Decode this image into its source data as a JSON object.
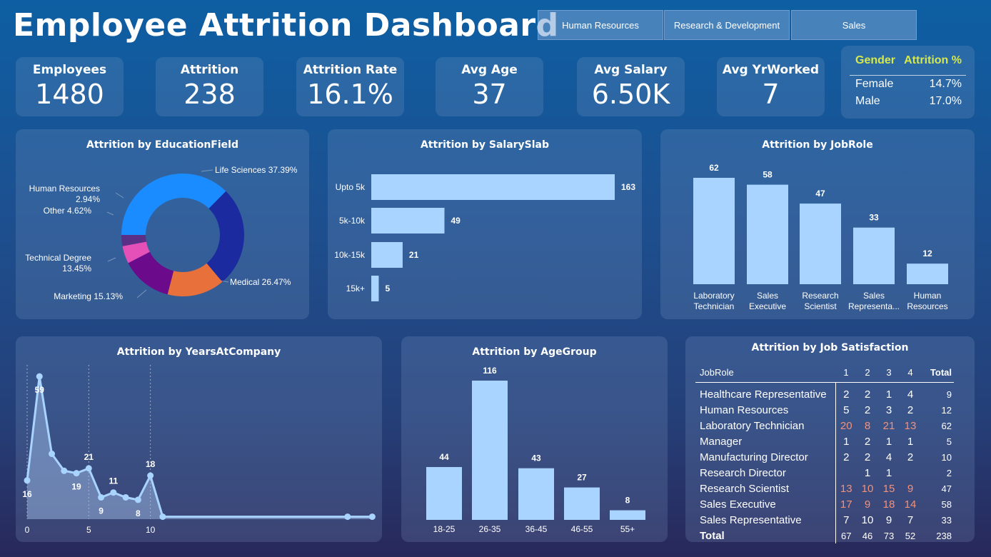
{
  "header": {
    "title": "Employee Attrition Dashboard",
    "filters": [
      "Human Resources",
      "Research & Development",
      "Sales"
    ]
  },
  "kpis": [
    {
      "label": "Employees",
      "value": "1480"
    },
    {
      "label": "Attrition",
      "value": "238"
    },
    {
      "label": "Attrition Rate",
      "value": "16.1%"
    },
    {
      "label": "Avg Age",
      "value": "37"
    },
    {
      "label": "Avg Salary",
      "value": "6.50K"
    },
    {
      "label": "Avg YrWorked",
      "value": "7"
    }
  ],
  "gender": {
    "col1": "Gender",
    "col2": "Attrition %",
    "rows": [
      {
        "g": "Female",
        "v": "14.7%"
      },
      {
        "g": "Male",
        "v": "17.0%"
      }
    ]
  },
  "colors": {
    "bar": "#a8d4ff",
    "accent": "#d6e84a",
    "highlight": "#f2917a"
  },
  "chart_data": [
    {
      "id": "education",
      "type": "pie",
      "title": "Attrition by EducationField",
      "slices": [
        {
          "label": "Life Sciences",
          "pct": 37.39,
          "text": "Life Sciences 37.39%",
          "color": "#1a8cff"
        },
        {
          "label": "Medical",
          "pct": 26.47,
          "text": "Medical 26.47%",
          "color": "#1c2aa0"
        },
        {
          "label": "Marketing",
          "pct": 15.13,
          "text": "Marketing 15.13%",
          "color": "#e8703a"
        },
        {
          "label": "Technical Degree",
          "pct": 13.45,
          "text": "Technical Degree 13.45%",
          "color": "#6b0a8a"
        },
        {
          "label": "Other",
          "pct": 4.62,
          "text": "Other 4.62%",
          "color": "#e44fb8"
        },
        {
          "label": "Human Resources",
          "pct": 2.94,
          "text": "Human Resources 2.94%",
          "color": "#5a2f86"
        }
      ]
    },
    {
      "id": "salary",
      "type": "bar",
      "title": "Attrition by SalarySlab",
      "orientation": "horizontal",
      "categories": [
        "Upto 5k",
        "5k-10k",
        "10k-15k",
        "15k+"
      ],
      "values": [
        163,
        49,
        21,
        5
      ]
    },
    {
      "id": "jobrole",
      "type": "bar",
      "title": "Attrition by JobRole",
      "categories": [
        [
          "Laboratory",
          "Technician"
        ],
        [
          "Sales",
          "Executive"
        ],
        [
          "Research",
          "Scientist"
        ],
        [
          "Sales",
          "Representa..."
        ],
        [
          "Human",
          "Resources"
        ]
      ],
      "values": [
        62,
        58,
        47,
        33,
        12
      ]
    },
    {
      "id": "years",
      "type": "area",
      "title": "Attrition by YearsAtCompany",
      "x": [
        0,
        1,
        2,
        3,
        4,
        5,
        6,
        7,
        8,
        9,
        10,
        11,
        12,
        13,
        14,
        15,
        16,
        17,
        18,
        19,
        20,
        21,
        22,
        23,
        24,
        25,
        26,
        27,
        28
      ],
      "y": [
        16,
        59,
        27,
        20,
        19,
        21,
        9,
        11,
        9,
        8,
        18,
        1,
        1,
        1,
        1,
        1,
        1,
        1,
        1,
        1,
        1,
        1,
        1,
        1,
        1,
        1,
        1,
        1,
        1
      ],
      "markers": [
        0,
        1,
        2,
        3,
        4,
        5,
        6,
        7,
        8,
        9,
        10,
        11,
        26,
        28
      ],
      "data_labels": [
        {
          "i": 0,
          "text": "16"
        },
        {
          "i": 1,
          "text": "59"
        },
        {
          "i": 4,
          "text": "19"
        },
        {
          "i": 5,
          "text": "21"
        },
        {
          "i": 6,
          "text": "9"
        },
        {
          "i": 7,
          "text": "11"
        },
        {
          "i": 9,
          "text": "8"
        },
        {
          "i": 10,
          "text": "18"
        }
      ],
      "xticks": [
        0,
        5,
        10
      ],
      "xlim": [
        0,
        28.5
      ],
      "ylim": [
        0,
        62
      ]
    },
    {
      "id": "age",
      "type": "bar",
      "title": "Attrition by AgeGroup",
      "categories": [
        "18-25",
        "26-35",
        "36-45",
        "46-55",
        "55+"
      ],
      "values": [
        44,
        116,
        43,
        27,
        8
      ]
    },
    {
      "id": "jobsat",
      "type": "table",
      "title": "Attrition by Job Satisfaction",
      "columns": [
        "JobRole",
        "1",
        "2",
        "3",
        "4",
        "Total"
      ],
      "rows": [
        [
          "Healthcare Representative",
          "2",
          "2",
          "1",
          "4",
          "9"
        ],
        [
          "Human Resources",
          "5",
          "2",
          "3",
          "2",
          "12"
        ],
        [
          "Laboratory Technician",
          "20",
          "8",
          "21",
          "13",
          "62"
        ],
        [
          "Manager",
          "1",
          "2",
          "1",
          "1",
          "5"
        ],
        [
          "Manufacturing Director",
          "2",
          "2",
          "4",
          "2",
          "10"
        ],
        [
          "Research Director",
          "",
          "1",
          "1",
          "",
          "2"
        ],
        [
          "Research Scientist",
          "13",
          "10",
          "15",
          "9",
          "47"
        ],
        [
          "Sales Executive",
          "17",
          "9",
          "18",
          "14",
          "58"
        ],
        [
          "Sales Representative",
          "7",
          "10",
          "9",
          "7",
          "33"
        ]
      ],
      "total": [
        "Total",
        "67",
        "46",
        "73",
        "52",
        "238"
      ]
    }
  ]
}
